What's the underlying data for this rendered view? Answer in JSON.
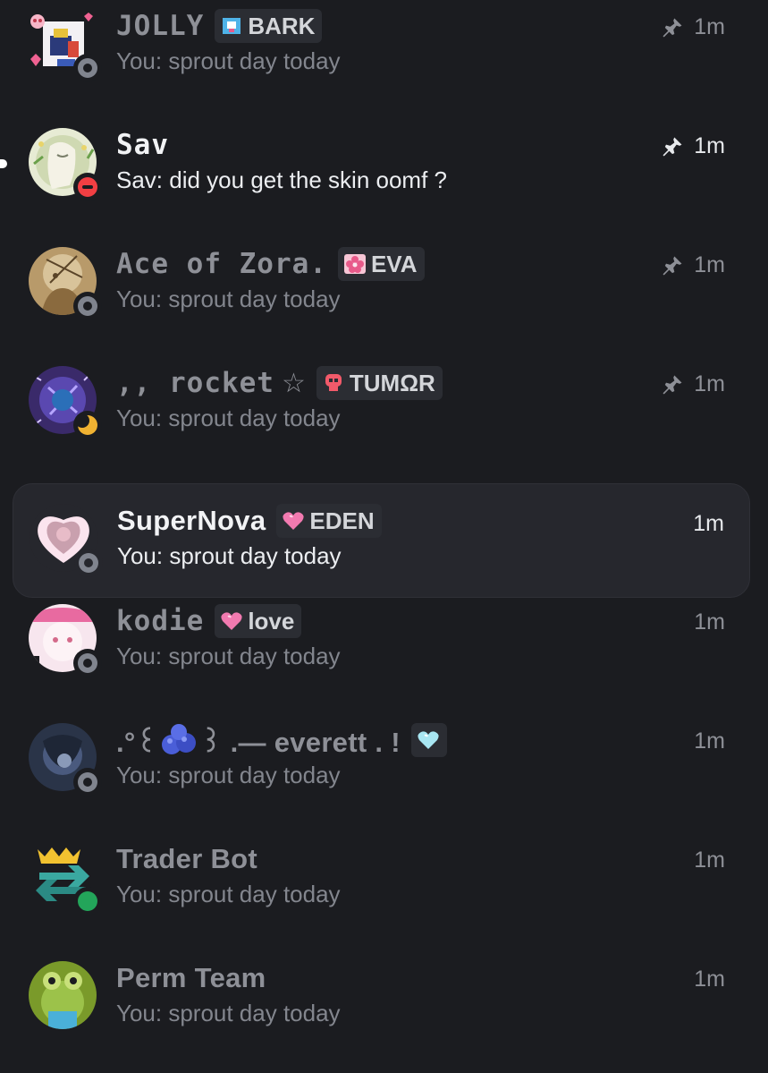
{
  "colors": {
    "background": "#1b1c20",
    "selected_row": "#26272d",
    "muted_text": "#8e9097",
    "offline": "#80848e",
    "dnd": "#f23f43",
    "online": "#23a55a",
    "idle": "#f0b232"
  },
  "conversations": [
    {
      "name": "JOLLY",
      "tag": {
        "label": "BARK",
        "icon": "bark-badge-icon"
      },
      "preview": "You: sprout day today",
      "time": "1m",
      "pinned": true,
      "status": "offline"
    },
    {
      "name": "Sav",
      "tag": null,
      "preview": "Sav: did you get the skin oomf ?",
      "time": "1m",
      "pinned": true,
      "status": "dnd",
      "unread": true
    },
    {
      "name": "Ace of Zora.",
      "tag": {
        "label": "EVA",
        "icon": "sakura-badge-icon"
      },
      "preview": "You: sprout day today",
      "time": "1m",
      "pinned": true,
      "status": "offline"
    },
    {
      "name": ",, rocket",
      "name_suffix": "☆",
      "tag": {
        "label": "TUMΩR",
        "icon": "skull-badge-icon"
      },
      "preview": "You: sprout day today",
      "time": "1m",
      "pinned": true,
      "status": "idle"
    },
    {
      "name": "SuperNova",
      "tag": {
        "label": "EDEN",
        "icon": "pink-heart-badge-icon"
      },
      "preview": "You: sprout day today",
      "time": "1m",
      "pinned": false,
      "status": "offline",
      "selected": true
    },
    {
      "name": "kodie",
      "tag": {
        "label": "love",
        "icon": "pink-heart-badge-icon"
      },
      "preview": "You: sprout day today",
      "time": "1m",
      "pinned": false,
      "status": "offline"
    },
    {
      "name": ".°꒰",
      "name_mid": "꒱ .— everett . !",
      "tag": {
        "label": "",
        "icon": "blue-heart-badge-icon"
      },
      "preview": "You: sprout day today",
      "time": "1m",
      "pinned": false,
      "status": "offline"
    },
    {
      "name": "Trader Bot",
      "tag": null,
      "preview": "You: sprout day today",
      "time": "1m",
      "pinned": false,
      "status": "online"
    },
    {
      "name": "Perm Team",
      "tag": null,
      "preview": "You: sprout day today",
      "time": "1m",
      "pinned": false,
      "status": "none"
    }
  ]
}
